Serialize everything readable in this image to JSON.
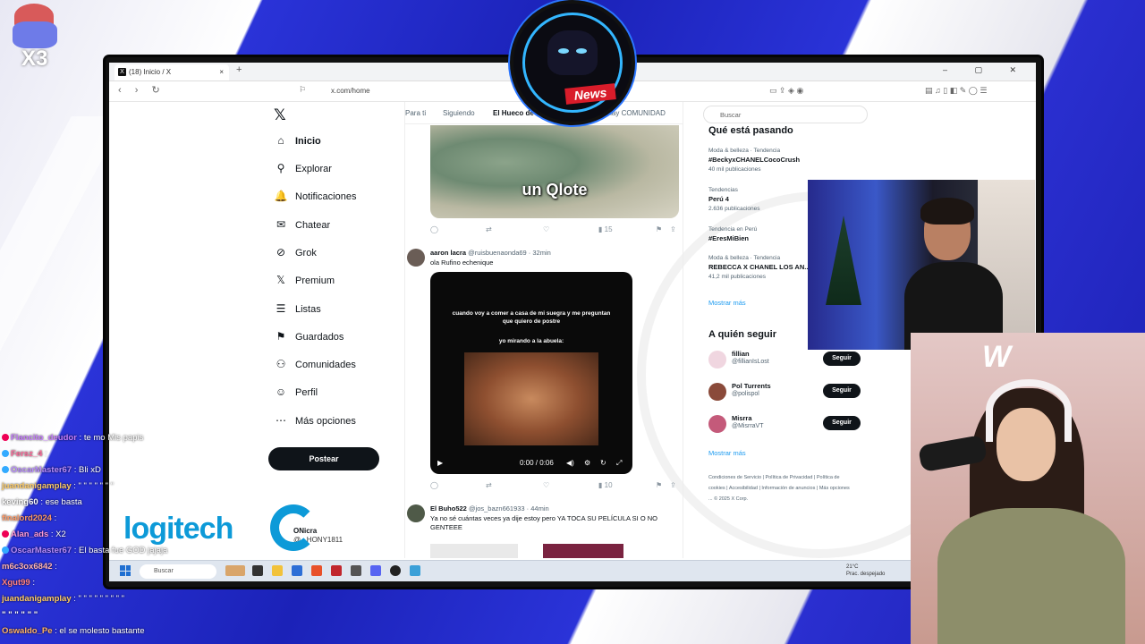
{
  "browser": {
    "tab_title": "(18) Inicio / X",
    "tab_close": "×",
    "new_tab": "+",
    "url": "x.com/home"
  },
  "x_sidebar": {
    "logo": "𝕏",
    "items": [
      {
        "icon": "home-icon",
        "glyph": "⌂",
        "label": "Inicio"
      },
      {
        "icon": "search-icon",
        "glyph": "⚲",
        "label": "Explorar"
      },
      {
        "icon": "bell-icon",
        "glyph": "🔔",
        "label": "Notificaciones"
      },
      {
        "icon": "mail-icon",
        "glyph": "✉",
        "label": "Chatear"
      },
      {
        "icon": "grok-icon",
        "glyph": "⊘",
        "label": "Grok"
      },
      {
        "icon": "x-premium-icon",
        "glyph": "𝕏",
        "label": "Premium"
      },
      {
        "icon": "list-icon",
        "glyph": "☰",
        "label": "Listas"
      },
      {
        "icon": "bookmark-icon",
        "glyph": "⚑",
        "label": "Guardados"
      },
      {
        "icon": "communities-icon",
        "glyph": "⚇",
        "label": "Comunidades"
      },
      {
        "icon": "profile-icon",
        "glyph": "☺",
        "label": "Perfil"
      },
      {
        "icon": "more-icon",
        "glyph": "⋯",
        "label": "Más opciones"
      }
    ],
    "post_button": "Postear",
    "account_name": "ONicra",
    "account_handle": "@...HONY1811"
  },
  "feed": {
    "tabs": [
      "Para ti",
      "Siguiendo",
      "El Hueco de Cra...",
      "...SI hay COMUNIDAD"
    ],
    "tweet1": {
      "media_caption": "un Qlote",
      "views": "15"
    },
    "tweet2": {
      "author": "aaron lacra",
      "handle": "@ruisbuenaonda69 · 32min",
      "text": "ola Rufino echenique",
      "video_text": "cuando voy a comer a casa de mi suegra y me preguntan que quiero de postre",
      "video_text2": "yo mirando a la abuela:",
      "video_time": "0:00 / 0:06",
      "views": "10"
    },
    "tweet3": {
      "author": "El Buho522",
      "handle": "@jos_bazn661933 · 44min",
      "text": "Ya no sé cuántas veces ya dije estoy pero YA TOCA SU PELÍCULA SI O NO GENTEEE"
    }
  },
  "right_panel": {
    "search_placeholder": "Buscar",
    "trending_title": "Qué está pasando",
    "trends": [
      {
        "meta": "Moda & belleza · Tendencia",
        "name": "#BeckyxCHANELCocoCrush",
        "count": "40 mil publicaciones"
      },
      {
        "meta": "Tendencias",
        "name": "Perú 4",
        "count": "2.636 publicaciones"
      },
      {
        "meta": "Tendencia en Perú",
        "name": "#EresMiBien",
        "count": ""
      },
      {
        "meta": "Moda & belleza · Tendencia",
        "name": "REBECCA X CHANEL LOS AN...",
        "count": "41,2 mil publicaciones"
      }
    ],
    "show_more": "Mostrar más",
    "follow_title": "A quién seguir",
    "follow": [
      {
        "name": "fillian",
        "handle": "@fillianIsLost",
        "button": "Seguir"
      },
      {
        "name": "Pol Turrents",
        "handle": "@polispol",
        "button": "Seguir"
      },
      {
        "name": "Misrra",
        "handle": "@MisrraVT",
        "button": "Seguir"
      }
    ],
    "show_more2": "Mostrar más",
    "footer": "Condiciones de Servicio | Política de Privacidad | Política de cookies | Accesibilidad | Información de anuncios | Más opciones ... © 2025 X Corp."
  },
  "taskbar": {
    "search": "Buscar",
    "weather_temp": "21°C",
    "weather_desc": "Prac. despejado"
  },
  "overlay": {
    "emblem_text": "News",
    "mascot_text": "X3",
    "sponsor": "logitech",
    "cam2_logo": "W"
  },
  "chat": [
    {
      "user": "Flancito_deudor",
      "text": ": te mo Mis papis",
      "color": "#c77dff"
    },
    {
      "user": "Fersz_4",
      "text": ":",
      "color": "#ff6b9b"
    },
    {
      "user": "OscarMaster67",
      "text": ": Bli xD",
      "color": "#b98cff"
    },
    {
      "user": "juandanigamplay",
      "text": ": \" \" \" \" \" \" \"",
      "color": "#ffcc66"
    },
    {
      "user": "keving60",
      "text": ": ese basta",
      "color": "#ffffff"
    },
    {
      "user": "finalord2024",
      "text": ":",
      "color": "#ff9966"
    },
    {
      "user": "Alan_ads",
      "text": ": X2",
      "color": "#ff9ad5"
    },
    {
      "user": "OscarMaster67",
      "text": ": El basta fue GOD jajaja",
      "color": "#b98cff"
    },
    {
      "user": "m6c3ox6842",
      "text": ":",
      "color": "#ffb3b3"
    },
    {
      "user": "Xgut99",
      "text": ":",
      "color": "#ff8080"
    },
    {
      "user": "juandanigamplay",
      "text": ": \" \" \" \" \" \" \" \" \"",
      "color": "#ffcc66"
    },
    {
      "user": "\" \" \" \" \" \"",
      "text": "",
      "color": "#ffffff"
    },
    {
      "user": "Oswaldo_Pe",
      "text": ": el se molesto bastante",
      "color": "#ffb366"
    }
  ]
}
